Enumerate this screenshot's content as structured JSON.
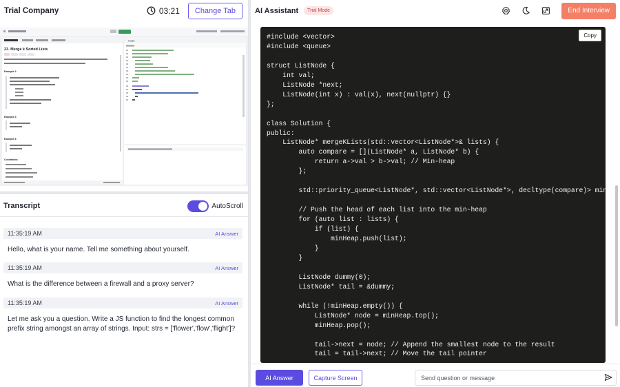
{
  "left": {
    "company": "Trial Company",
    "timer": "03:21",
    "change_tab": "Change Tab"
  },
  "preview": {
    "problem_title": "23. Merge k Sorted Lists",
    "code_tab": "Code",
    "badge_hard": "Hard",
    "body_lines": [
      "You are given an array of k linked-lists lists, each linked-list is sorted in ascending order.",
      "Merge all the linked-lists into one sorted linked-list and return it."
    ],
    "examples": [
      "Example 1:",
      "Example 2:",
      "Example 3:"
    ],
    "example_lines": [
      [
        "Input: lists = [[1,4,5],[1,3,4],[2,6]]",
        "Output: [1,1,2,3,4,4,5,6]",
        "Explanation: The linked-lists are:"
      ],
      [
        "Input: lists = []",
        "Output: []"
      ],
      [
        "Input: lists = [[]]",
        "Output: []"
      ]
    ],
    "constraints": "Constraints:",
    "status_text": "Saved to local   Upgrade to Cloud Saving"
  },
  "transcript": {
    "title": "Transcript",
    "autoscroll_label": "AutoScroll",
    "autoscroll_on": true,
    "messages": [
      {
        "time": "11:35:19 AM",
        "tag": "AI Answer",
        "text": "Hello, what is your name. Tell me something about yourself."
      },
      {
        "time": "11:35:19 AM",
        "tag": "AI Answer",
        "text": "What is the difference between a firewall and a proxy server?"
      },
      {
        "time": "11:35:19 AM",
        "tag": "AI Answer",
        "text": "Let me ask you a question. Write a JS function to find the longest common prefix string amongst an array of strings. Input: strs = ['flower','flow','flight']?"
      }
    ]
  },
  "assistant": {
    "title": "AI Assistant",
    "badge": "Trial Mode",
    "end_interview": "End Interview",
    "icons": [
      "gear-icon",
      "moon-icon",
      "popout-icon"
    ],
    "copy_label": "Copy",
    "code": "#include <vector>\n#include <queue>\n\nstruct ListNode {\n    int val;\n    ListNode *next;\n    ListNode(int x) : val(x), next(nullptr) {}\n};\n\nclass Solution {\npublic:\n    ListNode* mergeKLists(std::vector<ListNode*>& lists) {\n        auto compare = [](ListNode* a, ListNode* b) {\n            return a->val > b->val; // Min-heap\n        };\n\n        std::priority_queue<ListNode*, std::vector<ListNode*>, decltype(compare)> minHeap(compare);\n\n        // Push the head of each list into the min-heap\n        for (auto list : lists) {\n            if (list) {\n                minHeap.push(list);\n            }\n        }\n\n        ListNode dummy(0);\n        ListNode* tail = &dummy;\n\n        while (!minHeap.empty()) {\n            ListNode* node = minHeap.top();\n            minHeap.pop();\n\n            tail->next = node; // Append the smallest node to the result\n            tail = tail->next; // Move the tail pointer",
    "ai_answer_button": "AI Answer",
    "capture_button": "Capture Screen",
    "input_placeholder": "Send question or message",
    "colors": {
      "accent": "#5b4be0",
      "end_button": "#f47f66",
      "code_bg": "#1e1f1c",
      "badge_bg": "#fbe6e6",
      "badge_text": "#c0454b"
    }
  }
}
